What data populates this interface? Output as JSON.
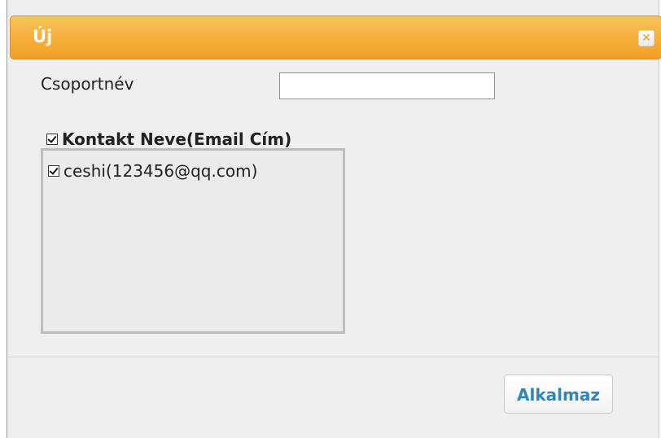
{
  "dialog": {
    "title": "Új",
    "close_icon": "close-icon",
    "accent_color": "#f5ae3a"
  },
  "form": {
    "group_name_label": "Csoportnév",
    "group_name_value": "",
    "group_name_placeholder": ""
  },
  "contacts": {
    "header_checked": true,
    "header_label": "Kontakt Neve(Email Cím)",
    "items": [
      {
        "checked": true,
        "label": "ceshi(123456@qq.com)"
      }
    ]
  },
  "footer": {
    "apply_label": "Alkalmaz",
    "apply_color": "#2e87b6"
  }
}
